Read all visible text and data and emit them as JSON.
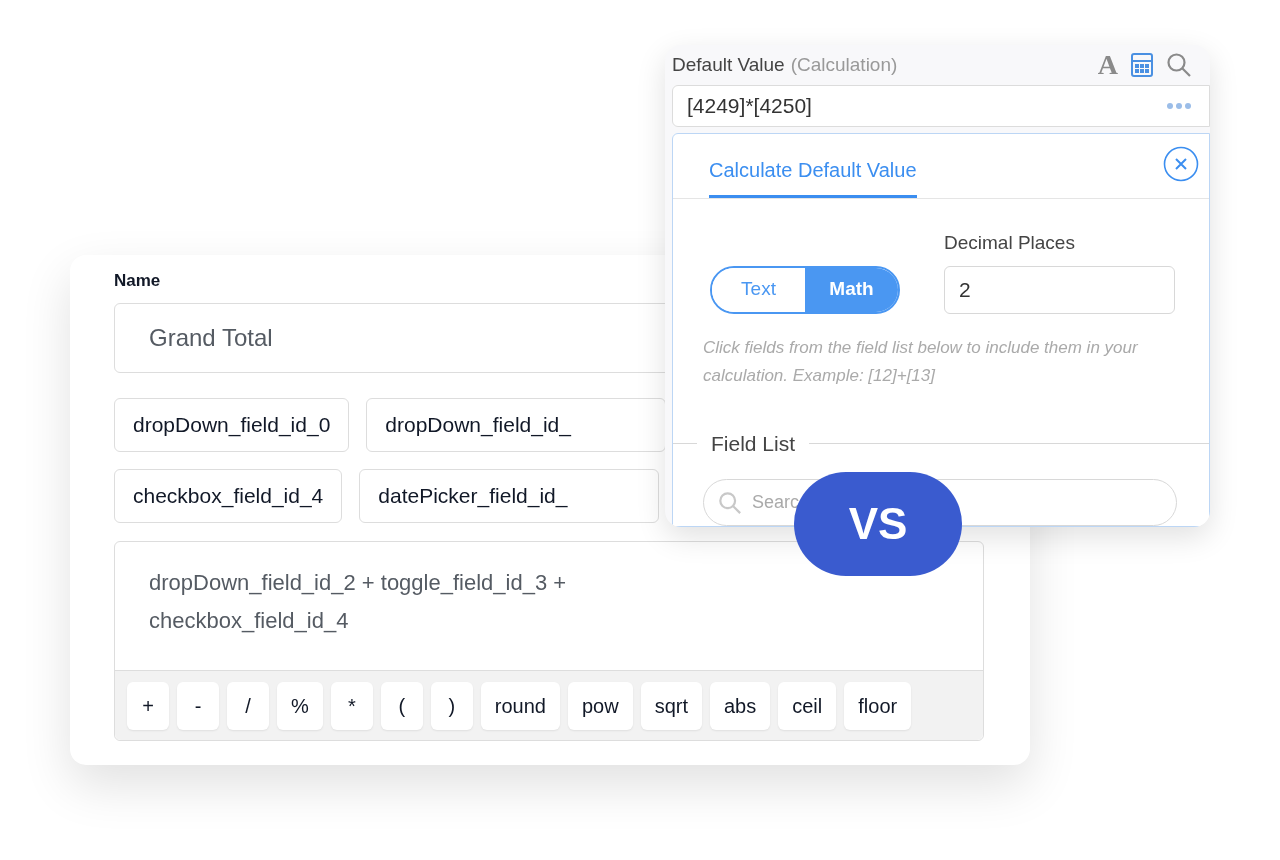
{
  "name_card": {
    "label": "Name",
    "value": "Grand Total",
    "chip_rows": [
      [
        "dropDown_field_id_0",
        "dropDown_field_id_"
      ],
      [
        "checkbox_field_id_4",
        "datePicker_field_id_"
      ]
    ],
    "formula": "dropDown_field_id_2 + toggle_field_id_3 + checkbox_field_id_4",
    "operators": [
      "+",
      "-",
      "/",
      "%",
      "*",
      "(",
      ")",
      "round",
      "pow",
      "sqrt",
      "abs",
      "ceil",
      "floor"
    ]
  },
  "calc_card": {
    "label": "Default Value",
    "label_note": "(Calculation)",
    "tools": [
      {
        "kind": "font",
        "glyph": "A",
        "selected": false
      },
      {
        "kind": "calculator",
        "selected": true
      },
      {
        "kind": "search",
        "selected": false
      }
    ],
    "value": "[4249]*[4250]",
    "tab": {
      "label": "Calculate Default Value",
      "selected": true
    },
    "modes": [
      {
        "label": "Text",
        "selected": false
      },
      {
        "label": "Math",
        "selected": true
      }
    ],
    "decimal_label": "Decimal Places",
    "decimal_value": "2",
    "hint": "Click fields from the field list below to include them in your calculation. Example: [12]+[13]",
    "field_list_title": "Field List",
    "search_placeholder": "Searc"
  },
  "badge": "VS"
}
